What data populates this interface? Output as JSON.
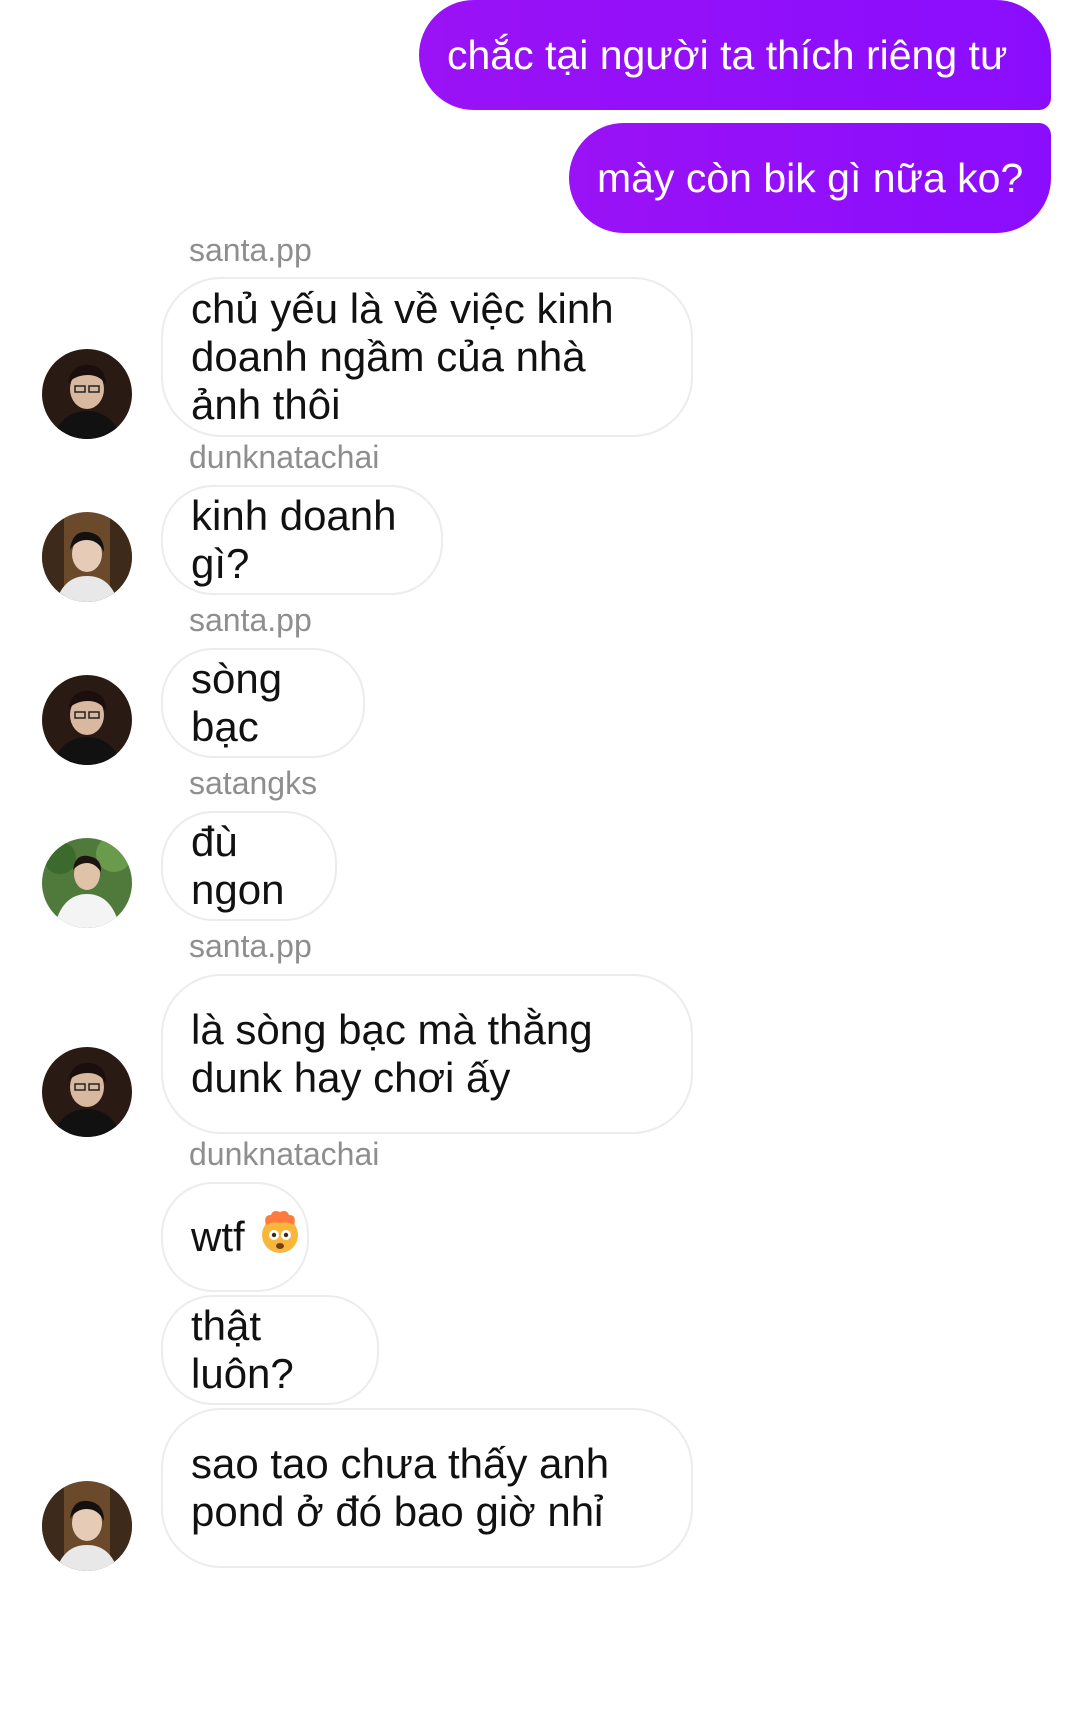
{
  "thread": {
    "outgoing": [
      {
        "text": "chắc tại người ta thích riêng tư"
      },
      {
        "text": "mày còn bik gì nữa ko?"
      }
    ],
    "groups": [
      {
        "sender": "santa.pp",
        "avatar": "santa-avatar",
        "messages": [
          "chủ yếu là về việc kinh doanh ngầm của nhà ảnh thôi"
        ]
      },
      {
        "sender": "dunknatachai",
        "avatar": "dunk-avatar",
        "messages": [
          "kinh doanh gì?"
        ]
      },
      {
        "sender": "santa.pp",
        "avatar": "santa-avatar",
        "messages": [
          "sòng bạc"
        ]
      },
      {
        "sender": "satangks",
        "avatar": "satang-avatar",
        "messages": [
          "đù ngon"
        ]
      },
      {
        "sender": "santa.pp",
        "avatar": "santa-avatar",
        "messages": [
          "là sòng bạc mà thằng dunk hay chơi ấy"
        ]
      },
      {
        "sender": "dunknatachai",
        "avatar": "dunk-avatar",
        "messages": [
          "wtf",
          "thật luôn?",
          "sao tao chưa thấy anh pond ở đó bao giờ nhỉ"
        ],
        "emoji": "exploding-head-emoji"
      }
    ]
  },
  "colors": {
    "outgoing_bubble": "#8a0dfd",
    "incoming_border": "#ececec",
    "sender_name": "#8e8e8e"
  }
}
